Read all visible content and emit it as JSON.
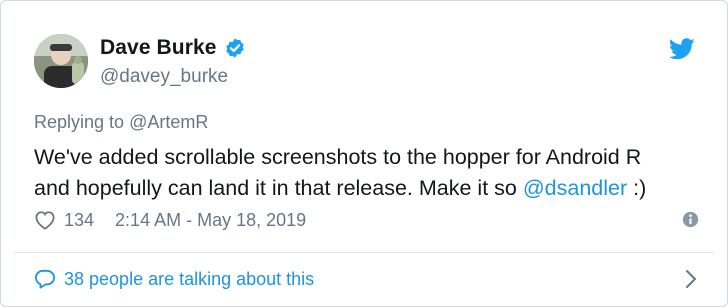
{
  "tweet": {
    "author": {
      "display_name": "Dave Burke",
      "handle": "@davey_burke",
      "verified": true,
      "avatar_icon": "user-avatar-photo"
    },
    "reply": {
      "prefix": "Replying to ",
      "target": "@ArtemR"
    },
    "text": {
      "line1": "We've added scrollable screenshots to the hopper for Android R",
      "line2_prefix": "and hopefully can land it in that release. Make it so ",
      "mention": "@dsandler",
      "line2_suffix": " :)"
    },
    "likes": "134",
    "timestamp": "2:14 AM - May 18, 2019",
    "conversation": "38 people are talking about this"
  },
  "icons": {
    "bird": "twitter-bird-icon",
    "verified": "verified-badge-icon",
    "heart": "heart-icon",
    "info": "info-icon",
    "reply": "speech-bubble-icon",
    "chevron": "chevron-right-icon"
  },
  "colors": {
    "brand_blue": "#1da1f2",
    "link_blue": "#1b95e0",
    "muted_gray": "#657786",
    "text_dark": "#14171a"
  }
}
